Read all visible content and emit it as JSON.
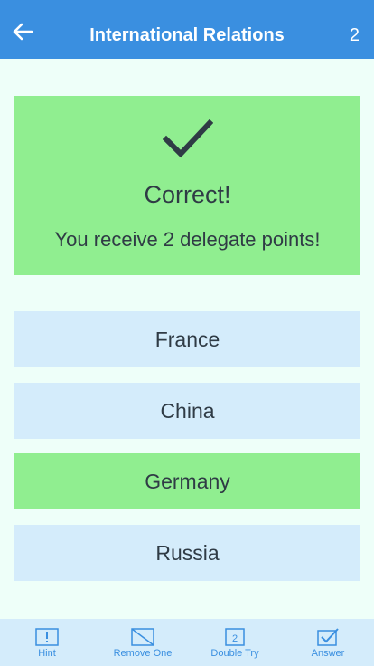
{
  "header": {
    "title": "International Relations",
    "counter": "2"
  },
  "result": {
    "title": "Correct!",
    "message": "You receive 2 delegate points!"
  },
  "options": [
    {
      "label": "France",
      "state": "default"
    },
    {
      "label": "China",
      "state": "default"
    },
    {
      "label": "Germany",
      "state": "correct"
    },
    {
      "label": "Russia",
      "state": "default"
    }
  ],
  "toolbar": {
    "hint_label": "Hint",
    "remove_label": "Remove One",
    "double_label": "Double Try",
    "double_icon_number": "2",
    "answer_label": "Answer"
  },
  "colors": {
    "header": "#3a8fe0",
    "background": "#eefff9",
    "correct": "#90ee90",
    "option": "#d4ecfb",
    "text": "#2f3b45"
  }
}
